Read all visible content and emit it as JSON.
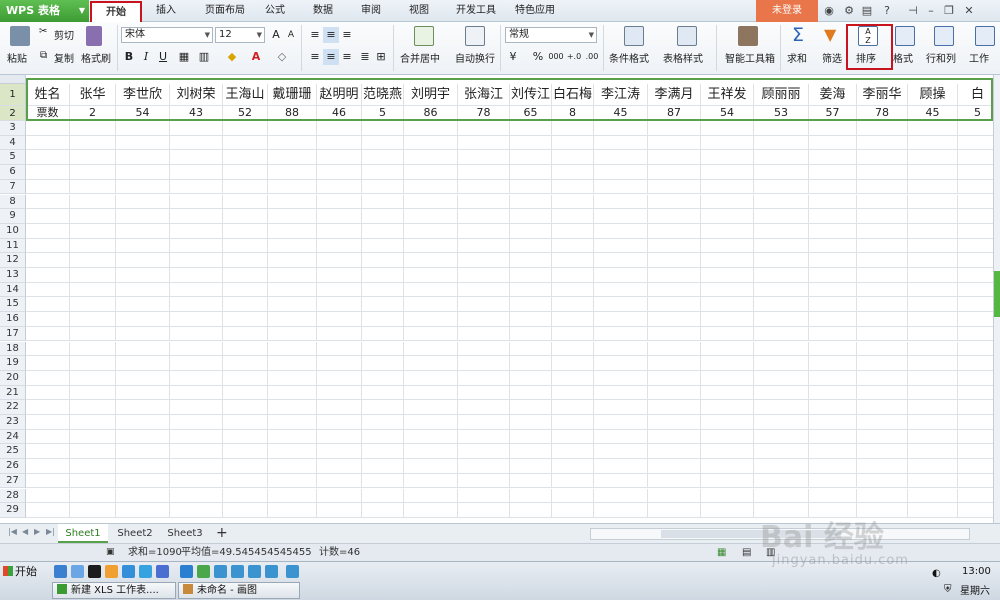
{
  "app": {
    "title": "WPS 表格"
  },
  "menu": {
    "tabs": [
      "开始",
      "插入",
      "页面布局",
      "公式",
      "数据",
      "审阅",
      "视图",
      "开发工具",
      "特色应用"
    ],
    "active_tab": "开始",
    "login_label": "未登录"
  },
  "ribbon": {
    "paste": "粘贴",
    "cut": "剪切",
    "copy": "复制",
    "format_painter": "格式刷",
    "font_name": "宋体",
    "font_size": "12",
    "bold": "B",
    "italic": "I",
    "underline": "U",
    "merge_center": "合并居中",
    "wrap_text": "自动换行",
    "number_format": "常规",
    "percent": "%",
    "thousands": "000",
    "cond_format": "条件格式",
    "table_style": "表格样式",
    "smart_toolbox": "智能工具箱",
    "sum": "求和",
    "filter": "筛选",
    "sort": "排序",
    "format": "格式",
    "row_col": "行和列",
    "worksheet": "工作"
  },
  "sheet": {
    "row1_label": "姓名",
    "row2_label": "票数",
    "names": [
      "张华",
      "李世欣",
      "刘树荣",
      "王海山",
      "戴珊珊",
      "赵明明",
      "范晓燕",
      "刘明宇",
      "张海江",
      "刘传江",
      "白石梅",
      "李江涛",
      "李满月",
      "王祥发",
      "顾丽丽",
      "姜海",
      "李丽华",
      "顾操",
      "白"
    ],
    "votes": [
      "2",
      "54",
      "43",
      "52",
      "88",
      "46",
      "5",
      "86",
      "78",
      "65",
      "8",
      "45",
      "87",
      "54",
      "53",
      "57",
      "78",
      "45",
      "5"
    ],
    "row_numbers": [
      "1",
      "2",
      "3",
      "4",
      "5",
      "6",
      "7",
      "8",
      "9",
      "10",
      "11",
      "12",
      "13",
      "14",
      "15",
      "16",
      "17",
      "18",
      "19",
      "20",
      "21",
      "22",
      "23",
      "24",
      "25",
      "26",
      "27",
      "28",
      "29"
    ]
  },
  "sheet_tabs": [
    "Sheet1",
    "Sheet2",
    "Sheet3"
  ],
  "active_sheet": "Sheet1",
  "status": {
    "sum": "求和=1090",
    "average": "平均值=49.545454545455",
    "count": "计数=46"
  },
  "taskbar": {
    "start": "开始",
    "tasks": [
      "新建 XLS 工作表....",
      "未命名 - 画图"
    ],
    "time": "13:00",
    "weekday": "星期六"
  },
  "watermark": {
    "main": "Bai 经验",
    "sub": "jingyan.baidu.com"
  },
  "colors": {
    "accent_green": "#59a04a",
    "highlight_red": "#c8141e",
    "login_orange": "#e9754a"
  }
}
